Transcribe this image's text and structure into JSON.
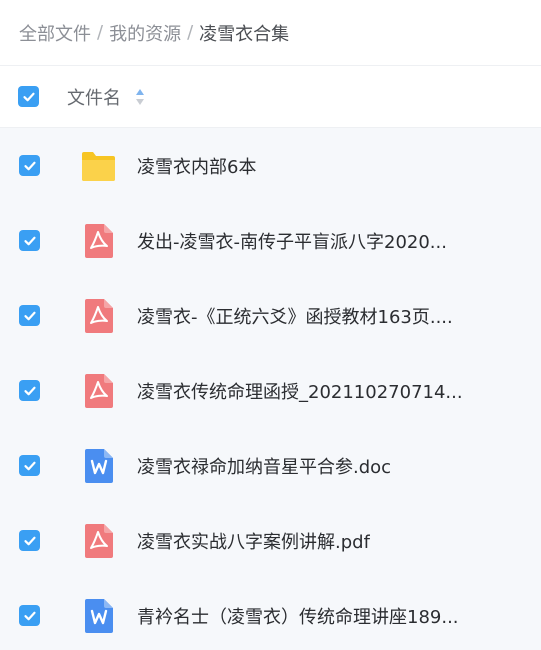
{
  "breadcrumb": {
    "items": [
      "全部文件",
      "我的资源",
      "凌雪衣合集"
    ],
    "separator": "/"
  },
  "header": {
    "column_label": "文件名",
    "sort_icon": "sort-updown-icon"
  },
  "files": [
    {
      "name": "凌雪衣内部6本",
      "type": "folder",
      "icon": "folder-icon"
    },
    {
      "name": "发出-凌雪衣-南传子平盲派八字2020...",
      "type": "pdf",
      "icon": "pdf-icon"
    },
    {
      "name": "凌雪衣-《正统六爻》函授教材163页....",
      "type": "pdf",
      "icon": "pdf-icon"
    },
    {
      "name": "凌雪衣传统命理函授_202110270714...",
      "type": "pdf",
      "icon": "pdf-icon"
    },
    {
      "name": "凌雪衣禄命加纳音星平合参.doc",
      "type": "doc",
      "icon": "word-icon"
    },
    {
      "name": "凌雪衣实战八字案例讲解.pdf",
      "type": "pdf",
      "icon": "pdf-icon"
    },
    {
      "name": "青衿名士（凌雪衣）传统命理讲座189...",
      "type": "doc",
      "icon": "word-icon"
    }
  ],
  "colors": {
    "accent": "#3a9ff3",
    "folder": "#f7c523",
    "pdf": "#f07a7d",
    "word": "#4a8ef0"
  }
}
